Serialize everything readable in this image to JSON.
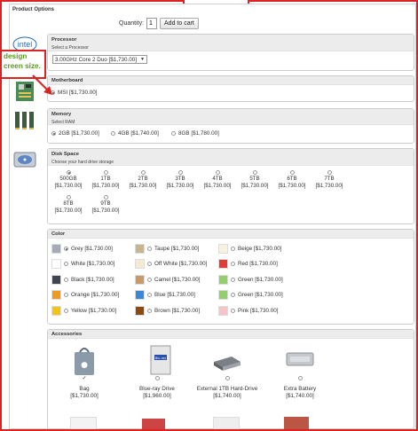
{
  "panel": {
    "title": "Product Options"
  },
  "quantity": {
    "label": "Quantity:",
    "value": "1",
    "button": "Add to cart"
  },
  "callout": {
    "line1": "design",
    "line2": "creen size."
  },
  "processor": {
    "title": "Processor",
    "subtitle": "Select a Processor",
    "selected": "3.00GHz Core 2 Duo  [$1,730.00]"
  },
  "motherboard": {
    "title": "Motherboard",
    "option": "MSI [$1,730.00]"
  },
  "memory": {
    "title": "Memory",
    "subtitle": "Select RAM",
    "options": [
      {
        "label": "2GB [$1,730.00]",
        "selected": true
      },
      {
        "label": "4GB [$1,740.00]",
        "selected": false
      },
      {
        "label": "8GB [$1,780.00]",
        "selected": false
      }
    ]
  },
  "disk": {
    "title": "Disk Space",
    "subtitle": "Choose your hard drive storage",
    "options": [
      {
        "size": "500GB",
        "price": "[$1,730.00]",
        "selected": true
      },
      {
        "size": "1TB",
        "price": "[$1,730.00]",
        "selected": false
      },
      {
        "size": "2TB",
        "price": "[$1,730.00]",
        "selected": false
      },
      {
        "size": "3TB",
        "price": "[$1,730.00]",
        "selected": false
      },
      {
        "size": "4TB",
        "price": "[$1,730.00]",
        "selected": false
      },
      {
        "size": "5TB",
        "price": "[$1,730.00]",
        "selected": false
      },
      {
        "size": "6TB",
        "price": "[$1,730.00]",
        "selected": false
      },
      {
        "size": "7TB",
        "price": "[$1,730.00]",
        "selected": false
      },
      {
        "size": "8TB",
        "price": "[$1,730.00]",
        "selected": false
      },
      {
        "size": "9TB",
        "price": "[$1,730.00]",
        "selected": false
      }
    ]
  },
  "color": {
    "title": "Color",
    "options": [
      {
        "label": "Grey [$1,730.00]",
        "hex": "#a6acb6",
        "selected": true
      },
      {
        "label": "Taupe [$1,730.00]",
        "hex": "#c8b58c",
        "selected": false
      },
      {
        "label": "Beige [$1,730.00]",
        "hex": "#f6f3dc",
        "selected": false
      },
      {
        "label": "White [$1,730.00]",
        "hex": "#ffffff",
        "selected": false
      },
      {
        "label": "Off White [$1,730.00]",
        "hex": "#f7ead5",
        "selected": false
      },
      {
        "label": "Red [$1,730.00]",
        "hex": "#e23b37",
        "selected": false
      },
      {
        "label": "Black [$1,730.00]",
        "hex": "#3d4650",
        "selected": false
      },
      {
        "label": "Camel [$1,730.00]",
        "hex": "#c79a6c",
        "selected": false
      },
      {
        "label": "Green [$1,730.00]",
        "hex": "#93cf6c",
        "selected": false
      },
      {
        "label": "Orange [$1,730.00]",
        "hex": "#ef9b1e",
        "selected": false
      },
      {
        "label": "Blue [$1,730.00]",
        "hex": "#3b88d8",
        "selected": false
      },
      {
        "label": "Green [$1,730.00]",
        "hex": "#93cf6c",
        "selected": false
      },
      {
        "label": "Yellow [$1,730.00]",
        "hex": "#f3c21b",
        "selected": false
      },
      {
        "label": "Brown [$1,730.00]",
        "hex": "#8c4a10",
        "selected": false
      },
      {
        "label": "Pink [$1,730.00]",
        "hex": "#f6c3c6",
        "selected": false
      }
    ]
  },
  "accessories": {
    "title": "Accessories",
    "items": [
      {
        "name": "Bag",
        "price": "[$1,730.00]",
        "checked": true
      },
      {
        "name": "Blue-ray Drive",
        "price": "[$1,960.00]",
        "checked": false
      },
      {
        "name": "External 1TB Hard-Drive",
        "price": "[$1,740.00]",
        "checked": false
      },
      {
        "name": "Extra Battery",
        "price": "[$1,740.00]",
        "checked": false
      }
    ]
  }
}
